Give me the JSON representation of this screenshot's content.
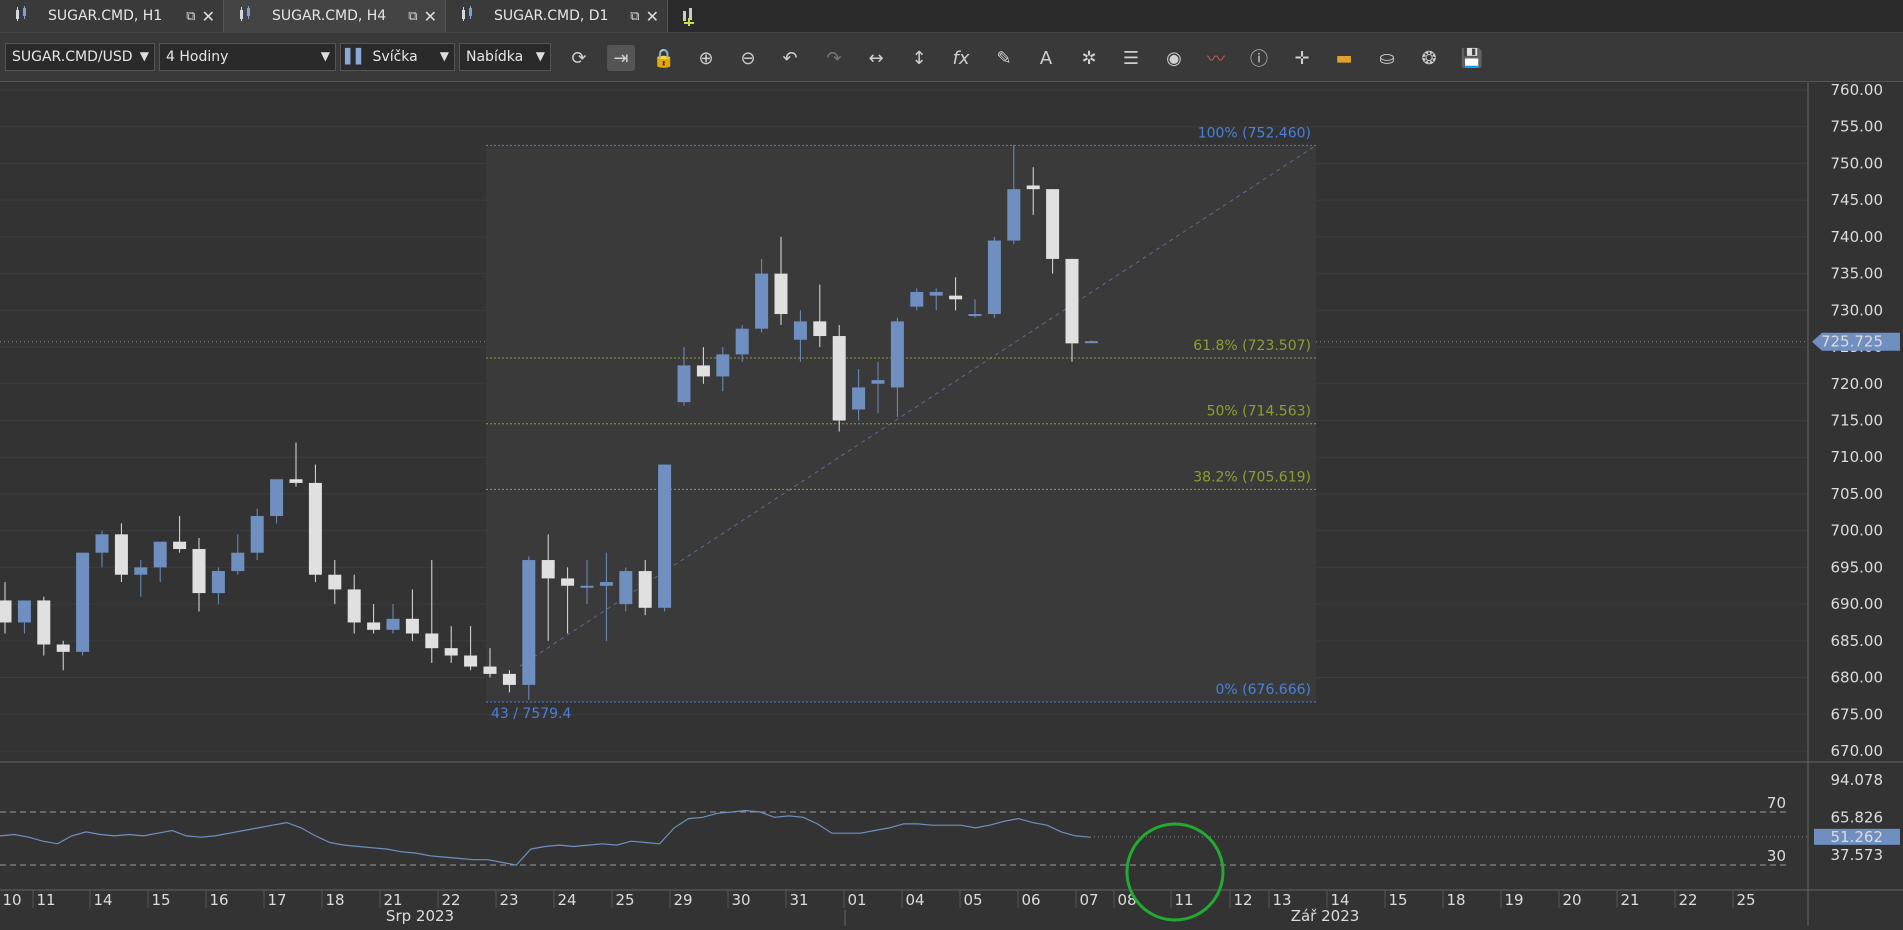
{
  "tabs": [
    {
      "label": "SUGAR.CMD, H1"
    },
    {
      "label": "SUGAR.CMD, H4"
    },
    {
      "label": "SUGAR.CMD, D1"
    }
  ],
  "toolbar": {
    "instrument": "SUGAR.CMD/USD",
    "period": "4 Hodiny",
    "chart_type": "Svíčka",
    "side": "Nabídka"
  },
  "colors": {
    "bull": "#6f8fc0",
    "bear": "#e0e0e0",
    "fib_blue": "#4a80d8",
    "fib_green": "#8aa030",
    "rsi": "#6f8fc0"
  },
  "chart_data": {
    "type": "candlestick",
    "symbol": "SUGAR.CMD/USD",
    "ylim": [
      668,
      762
    ],
    "y_ticks": [
      "760.00",
      "755.00",
      "750.00",
      "745.00",
      "740.00",
      "735.00",
      "730.00",
      "725.00",
      "720.00",
      "715.00",
      "710.00",
      "705.00",
      "700.00",
      "695.00",
      "690.00",
      "685.00",
      "680.00",
      "675.00",
      "670.00"
    ],
    "current_price": "725.725",
    "candles": [
      [
        690.5,
        693,
        686,
        687.5
      ],
      [
        687.5,
        690,
        686,
        690.5
      ],
      [
        690.5,
        691,
        683,
        684.5
      ],
      [
        684.5,
        685,
        681,
        683.5
      ],
      [
        683.5,
        697,
        683,
        697
      ],
      [
        697,
        700,
        695,
        699.5
      ],
      [
        699.5,
        701,
        693,
        694
      ],
      [
        694,
        696,
        691,
        695
      ],
      [
        695,
        697,
        693,
        698.5
      ],
      [
        698.5,
        702,
        697,
        697.5
      ],
      [
        697.5,
        699,
        689,
        691.5
      ],
      [
        691.5,
        695,
        690,
        694.5
      ],
      [
        694.5,
        699.5,
        694,
        697
      ],
      [
        697,
        703,
        696,
        702
      ],
      [
        702,
        707,
        701,
        707
      ],
      [
        707,
        712,
        706,
        706.5
      ],
      [
        706.5,
        709,
        693,
        694
      ],
      [
        694,
        696,
        690,
        692
      ],
      [
        692,
        694,
        686,
        687.5
      ],
      [
        687.5,
        690,
        686,
        686.5
      ],
      [
        686.5,
        690,
        686,
        688
      ],
      [
        688,
        692,
        685,
        686
      ],
      [
        686,
        696,
        682,
        684
      ],
      [
        684,
        687,
        682,
        683
      ],
      [
        683,
        687,
        681,
        681.5
      ],
      [
        681.5,
        684,
        680,
        680.5
      ],
      [
        680.5,
        681,
        678,
        679
      ],
      [
        679,
        696.5,
        677,
        696
      ],
      [
        696,
        699.5,
        685,
        693.5
      ],
      [
        693.5,
        695,
        686,
        692.5
      ],
      [
        692.5,
        696,
        690,
        692.5
      ],
      [
        692.5,
        697,
        685,
        693
      ],
      [
        690,
        695,
        689,
        694.5
      ],
      [
        694.5,
        696,
        688.5,
        689.5
      ],
      [
        689.5,
        709,
        689,
        709
      ],
      [
        717.5,
        725,
        717,
        722.5
      ],
      [
        722.5,
        725,
        720,
        721
      ],
      [
        721,
        725,
        719,
        724
      ],
      [
        724,
        728,
        723,
        727.5
      ],
      [
        727.5,
        737,
        727,
        735
      ],
      [
        735,
        740,
        728,
        729.5
      ],
      [
        726,
        730,
        723,
        728.5
      ],
      [
        728.5,
        733.5,
        725,
        726.5
      ],
      [
        726.5,
        728,
        713.5,
        715
      ],
      [
        716.5,
        722,
        715,
        719.5
      ],
      [
        720,
        723,
        716,
        720.5
      ],
      [
        719.5,
        729,
        715.5,
        728.5
      ],
      [
        730.5,
        733,
        730,
        732.5
      ],
      [
        732,
        733,
        730,
        732.5
      ],
      [
        732,
        734.5,
        730,
        731.5
      ],
      [
        729.5,
        731.5,
        729,
        729.5
      ],
      [
        729.5,
        740,
        729,
        739.5
      ],
      [
        739.5,
        752.5,
        739,
        746.5
      ],
      [
        747,
        749.5,
        743,
        746.5
      ],
      [
        746.5,
        746.5,
        735,
        737
      ],
      [
        737,
        737,
        723,
        725.5
      ],
      [
        725.7,
        725.9,
        725.6,
        725.8
      ]
    ],
    "fibonacci": [
      {
        "label": "100% (752.460)",
        "value": 752.46
      },
      {
        "label": "61.8% (723.507)",
        "value": 723.507
      },
      {
        "label": "50% (714.563)",
        "value": 714.563
      },
      {
        "label": "38.2% (705.619)",
        "value": 705.619
      },
      {
        "label": "0% (676.666)",
        "value": 676.666
      }
    ],
    "anchor_label": "43 / 7579.4",
    "rsi": {
      "ticks": [
        "94.078",
        "65.826",
        "37.573"
      ],
      "levels": [
        "70",
        "30"
      ],
      "current": "51.262",
      "values": [
        52,
        53,
        51,
        48,
        46,
        52,
        55,
        53,
        52,
        53,
        52,
        54,
        56,
        52,
        51,
        52,
        54,
        56,
        58,
        60,
        62,
        58,
        52,
        47,
        45,
        44,
        43,
        42,
        40,
        39,
        37,
        36,
        35,
        34,
        34,
        32,
        30,
        42,
        44,
        45,
        44,
        45,
        46,
        45,
        48,
        47,
        46,
        58,
        65,
        66,
        69,
        70,
        71,
        70,
        66,
        67,
        66,
        61,
        54,
        54,
        54,
        56,
        58,
        61,
        61,
        60,
        60,
        60,
        58,
        60,
        63,
        65,
        62,
        60,
        55,
        52,
        51
      ]
    },
    "x_ticks": [
      "10",
      "11",
      "14",
      "15",
      "16",
      "17",
      "18",
      "21",
      "22",
      "23",
      "24",
      "25",
      "29",
      "30",
      "31",
      "01",
      "04",
      "05",
      "06",
      "07",
      "08",
      "11",
      "12",
      "13",
      "14",
      "15",
      "18",
      "19",
      "20",
      "21",
      "22",
      "25"
    ],
    "x_months": [
      "Srp 2023",
      "Zář 2023"
    ]
  }
}
